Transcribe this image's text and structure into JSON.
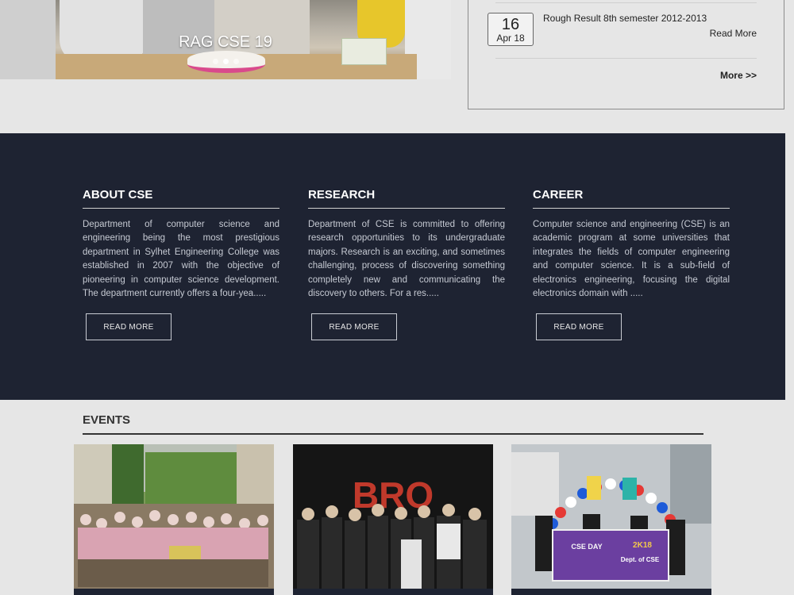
{
  "slider": {
    "caption": "RAG CSE 19",
    "dots": 3,
    "active_dot": 2
  },
  "notice": {
    "day": "16",
    "month": "Apr 18",
    "title": "Rough Result 8th semester 2012-2013",
    "read_more": "Read More",
    "more": "More >>"
  },
  "info": {
    "columns": [
      {
        "title": "ABOUT CSE",
        "text": "Department of computer science and engineering being the most prestigious department in Sylhet Engineering College was established in 2007 with the objective of pioneering in computer science development. The department currently offers a four-yea.....",
        "button": "READ MORE"
      },
      {
        "title": "RESEARCH",
        "text": "Department of CSE is committed to offering research opportunities to its undergraduate majors. Research is an exciting, and sometimes challenging, process of discovering something completely new and communicating the discovery to others. For a res.....",
        "button": "READ MORE"
      },
      {
        "title": "CAREER",
        "text": "Computer science and engineering (CSE) is an academic program at some universities that integrates the fields of computer engineering and computer science. It is a sub-field of electronics engineering, focusing the digital electronics domain with .....",
        "button": "READ MORE"
      }
    ]
  },
  "events": {
    "title": "EVENTS",
    "cards": [
      {
        "image": "holi-celebration-photo"
      },
      {
        "image": "bro-night-photo",
        "sign": "BRO"
      },
      {
        "image": "cse-day-photo",
        "banner_line1": "CSE DAY",
        "banner_line2": "2K18",
        "banner_line3": "Dept. of CSE"
      }
    ]
  },
  "colors": {
    "page_bg": "#e6e6e6",
    "dark_section": "#1e2332",
    "text_dark": "#333333"
  }
}
